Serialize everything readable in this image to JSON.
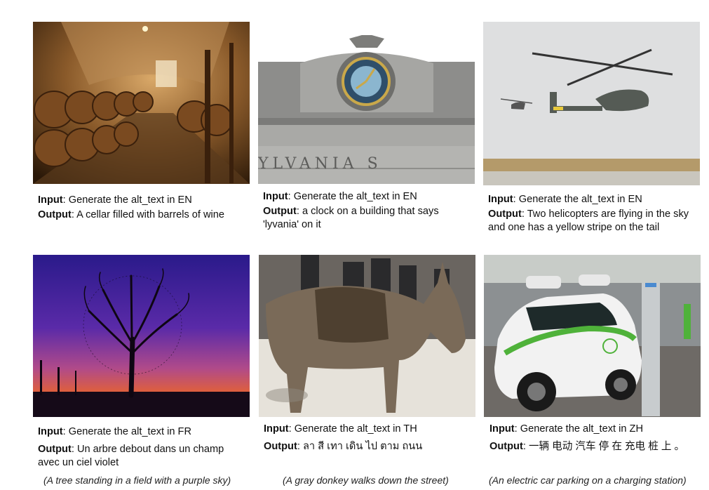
{
  "labels": {
    "input": "Input",
    "output": "Output"
  },
  "panels": [
    {
      "input": "Generate the alt_text in EN",
      "output": "A cellar filled with barrels of wine",
      "caption": ""
    },
    {
      "input": "Generate the alt_text in EN",
      "output": "a clock on a building that says 'lyvania' on it",
      "caption": "",
      "sign_text": "YLVANIA  S"
    },
    {
      "input": "Generate the alt_text in EN",
      "output": "Two helicopters are flying in the sky and one has a yellow stripe on the tail",
      "caption": ""
    },
    {
      "input": "Generate the alt_text in FR",
      "output": "Un arbre debout dans un champ avec un ciel violet",
      "caption": "(A tree standing in a field with a purple sky)"
    },
    {
      "input": "Generate the alt_text in TH",
      "output": "ลา สี เทา เดิน ไป ตาม ถนน",
      "caption": "(A gray donkey walks down the street)"
    },
    {
      "input": "Generate the alt_text in ZH",
      "output": "一辆 电动 汽车 停 在 充电 桩 上 。",
      "caption": "(An electric car parking on a charging station)"
    }
  ]
}
